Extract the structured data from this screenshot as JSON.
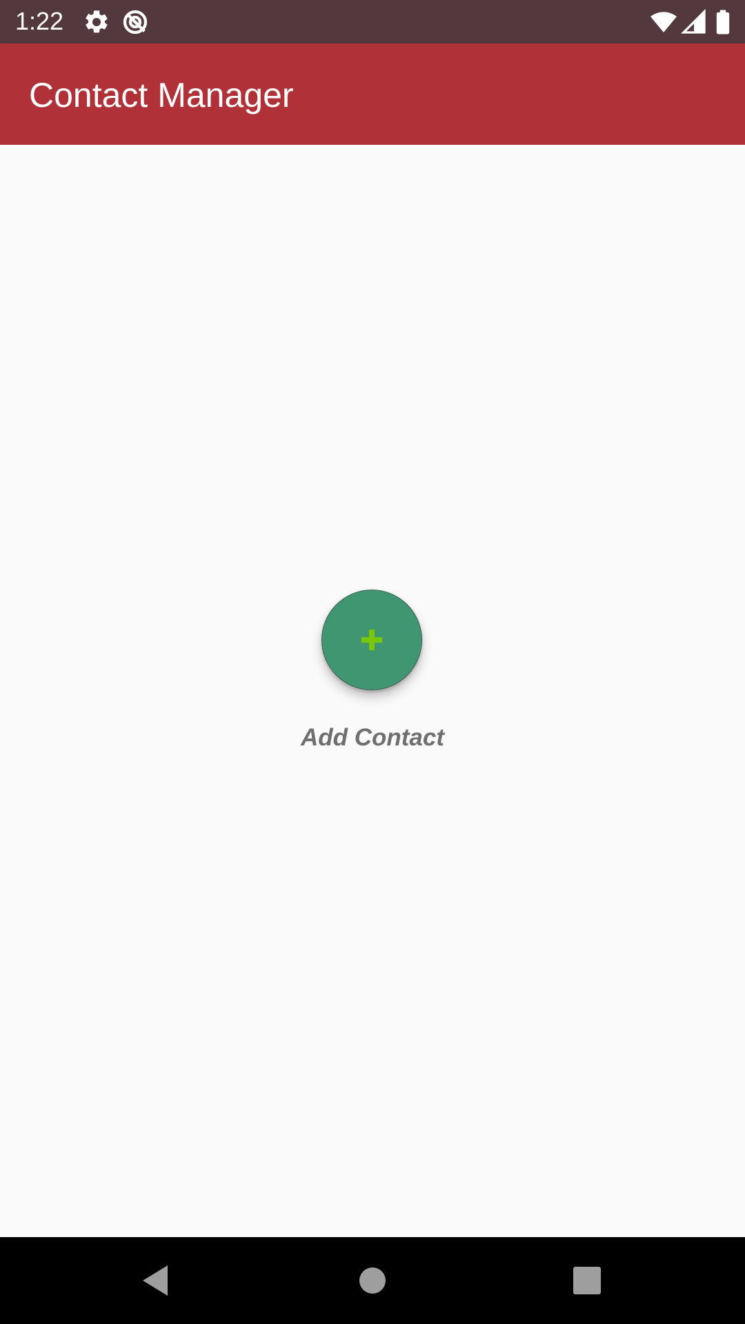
{
  "status_bar": {
    "time": "1:22",
    "icons": [
      "settings-icon",
      "data-saver-icon",
      "wifi-icon",
      "cellular-signal-icon",
      "battery-icon"
    ]
  },
  "app_bar": {
    "title": "Contact Manager"
  },
  "main": {
    "add_contact_button": {
      "icon": "plus-icon",
      "label": "Add Contact"
    }
  },
  "nav_bar": {
    "buttons": [
      "back-icon",
      "home-icon",
      "recents-icon"
    ]
  },
  "colors": {
    "status_bar": "#53383d",
    "app_bar": "#b03238",
    "fab": "#419672",
    "plus": "#7ac70a",
    "label": "#6f6f6f",
    "background": "#fafafa",
    "nav_bar": "#000000"
  }
}
